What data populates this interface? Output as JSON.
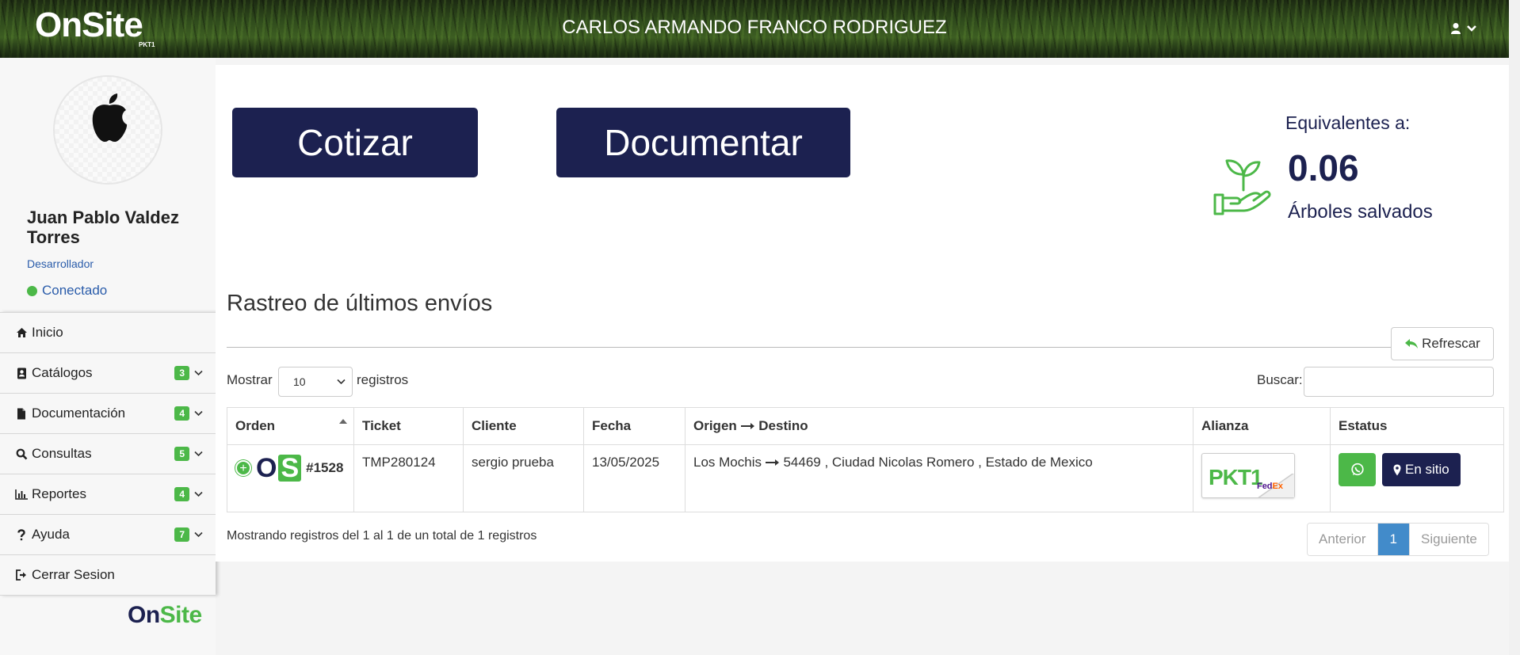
{
  "header": {
    "brand": "OnSite",
    "brand_sub": "PKT1",
    "user": "CARLOS ARMANDO FRANCO RODRIGUEZ"
  },
  "sidebar": {
    "profile": {
      "name": "Juan Pablo Valdez Torres",
      "role": "Desarrollador",
      "status": "Conectado"
    },
    "items": [
      {
        "label": "Inicio",
        "icon": "home-icon"
      },
      {
        "label": "Catálogos",
        "badge": "3",
        "icon": "address-book-icon"
      },
      {
        "label": "Documentación",
        "badge": "4",
        "icon": "file-icon"
      },
      {
        "label": "Consultas",
        "badge": "5",
        "icon": "search-icon"
      },
      {
        "label": "Reportes",
        "badge": "4",
        "icon": "bar-chart-icon"
      },
      {
        "label": "Ayuda",
        "badge": "7",
        "icon": "question-icon"
      },
      {
        "label": "Cerrar Sesion",
        "icon": "sign-out-icon"
      }
    ],
    "footer_logo": {
      "on": "On",
      "site": "Site"
    }
  },
  "actions": {
    "cotizar": "Cotizar",
    "documentar": "Documentar"
  },
  "equivalents": {
    "title": "Equivalentes a:",
    "value": "0.06",
    "label": "Árboles salvados"
  },
  "tracking": {
    "title": "Rastreo de últimos envíos",
    "refresh": "Refrescar",
    "length_prefix": "Mostrar",
    "length_value": "10",
    "length_suffix": "registros",
    "search_label": "Buscar:",
    "search_value": "",
    "columns": [
      "Orden",
      "Ticket",
      "Cliente",
      "Fecha",
      "Origen",
      "Destino",
      "Alianza",
      "Estatus"
    ],
    "rows": [
      {
        "order": "#1528",
        "ticket": "TMP280124",
        "client": "sergio prueba",
        "date": "13/05/2025",
        "origin": "Los Mochis",
        "destination": "54469 , Ciudad Nicolas Romero , Estado de Mexico",
        "alliance": {
          "pkt": "PKT1",
          "fed": "Fed",
          "ex": "Ex"
        },
        "status": "En sitio"
      }
    ],
    "info": "Mostrando registros del 1 al 1 de un total de 1 registros",
    "pager": {
      "prev": "Anterior",
      "current": "1",
      "next": "Siguiente"
    }
  },
  "colors": {
    "navy": "#1c2150",
    "green": "#4cb848",
    "link": "#2a5caa",
    "pager_active": "#428bca"
  }
}
